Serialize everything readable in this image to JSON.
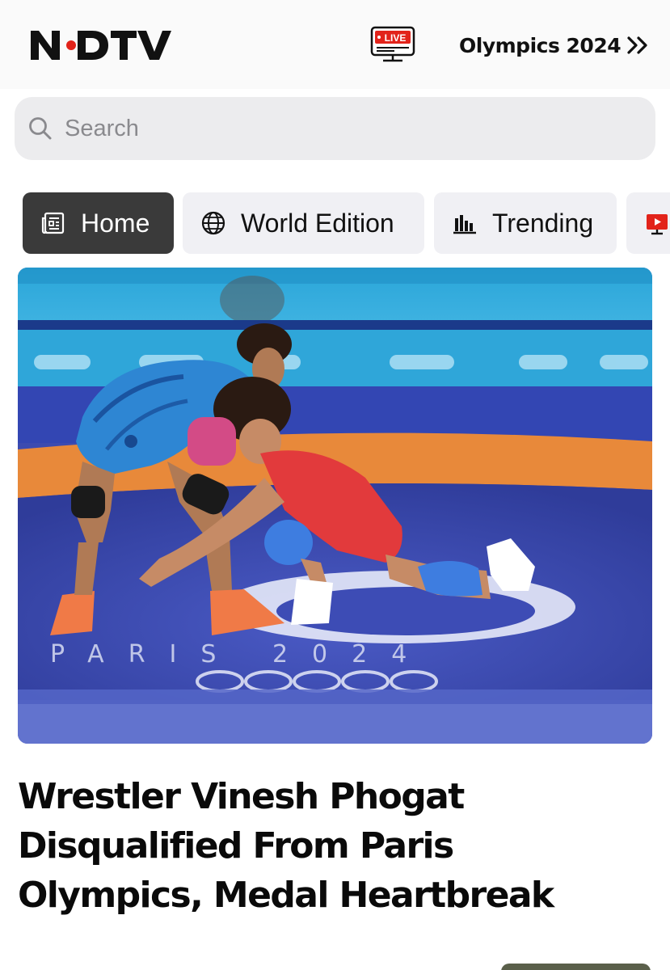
{
  "header": {
    "logo_text": "NDTV",
    "live_label": "LIVE",
    "live_icon": "tv-live-icon",
    "olympics_link_label": "Olympics 2024",
    "olympics_link_icon": "double-chevron-right-icon"
  },
  "search": {
    "placeholder": "Search",
    "value": "",
    "icon": "search-icon"
  },
  "tabs": [
    {
      "label": "Home",
      "icon": "newspaper-icon",
      "active": true
    },
    {
      "label": "World Edition",
      "icon": "globe-icon",
      "active": false
    },
    {
      "label": "Trending",
      "icon": "bar-chart-icon",
      "active": false
    },
    {
      "label": "",
      "icon": "video-play-icon",
      "active": false
    }
  ],
  "hero": {
    "image": "wrestling-match-photo",
    "mat_text": "PARIS 2024"
  },
  "article": {
    "headline": "Wrestler Vinesh Phogat Disqualified From Paris Olympics, Medal Heartbreak"
  },
  "colors": {
    "brand_red": "#e2231a",
    "active_tab_bg": "#3a3a3a",
    "tab_bg": "#f0f0f4",
    "search_bg": "#ececee",
    "mat_blue": "#3d4cb5",
    "mat_orange": "#e8893a",
    "mat_cyan": "#2fa6d9"
  }
}
